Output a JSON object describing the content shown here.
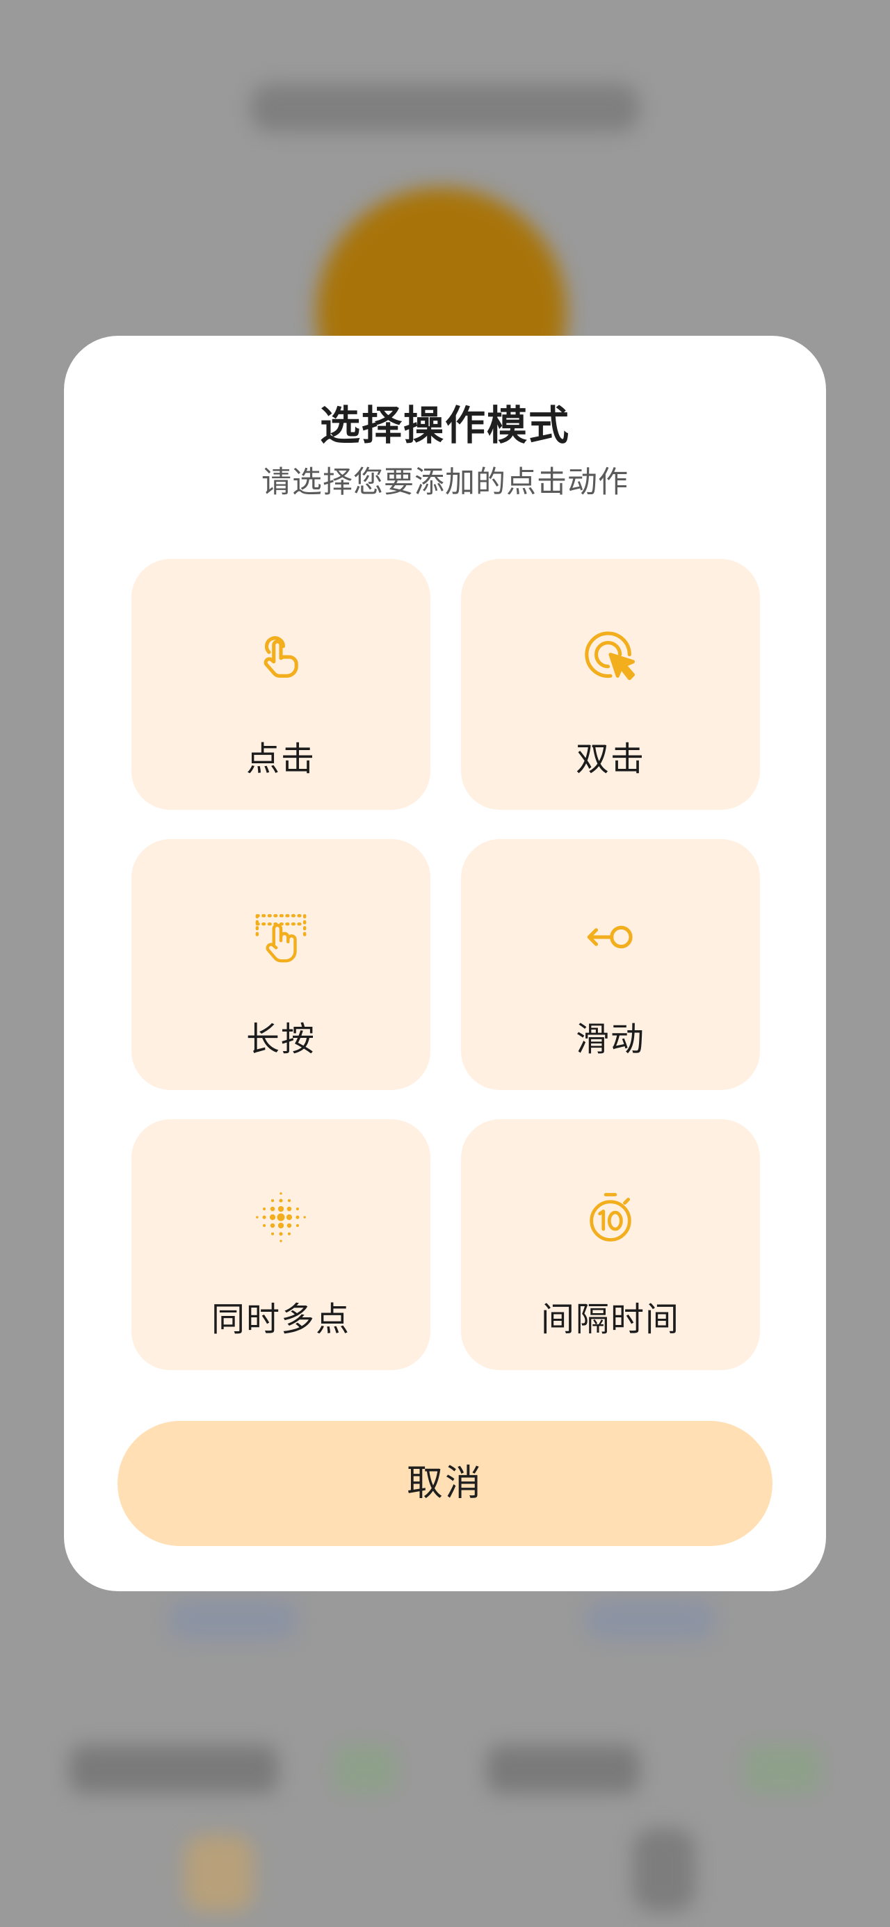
{
  "dialog": {
    "title": "选择操作模式",
    "subtitle": "请选择您要添加的点击动作",
    "options": [
      {
        "label": "点击",
        "icon": "tap-icon"
      },
      {
        "label": "双击",
        "icon": "double-tap-icon"
      },
      {
        "label": "长按",
        "icon": "long-press-icon"
      },
      {
        "label": "滑动",
        "icon": "swipe-icon"
      },
      {
        "label": "同时多点",
        "icon": "multi-point-icon"
      },
      {
        "label": "间隔时间",
        "icon": "timer-icon"
      }
    ],
    "cancel_label": "取消"
  },
  "colors": {
    "accent": "#F2AE1C",
    "card_bg": "#FFF0E2",
    "cancel_bg": "#FFDFB3",
    "overlay": "#9A9A9A"
  }
}
